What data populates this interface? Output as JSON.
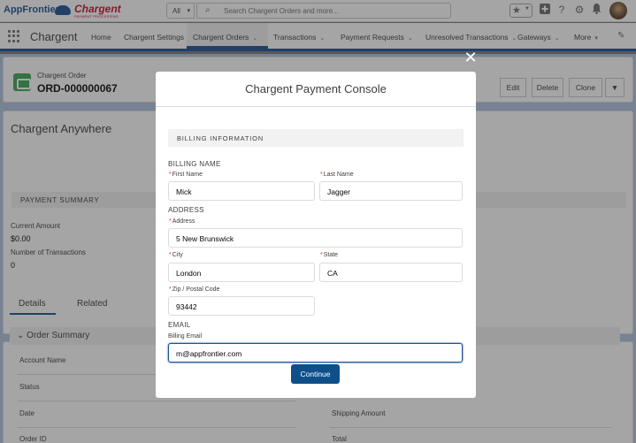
{
  "topbar": {
    "logo_appfrontier": "AppFrontier",
    "logo_chargent": "Chargent",
    "logo_chargent_sub": "PAYMENT PROCESSING",
    "search_scope": "All",
    "search_placeholder": "Search Chargent Orders and more..."
  },
  "nav": {
    "app_name": "Chargent",
    "items": [
      {
        "label": "Home"
      },
      {
        "label": "Chargent Settings"
      },
      {
        "label": "Chargent Orders"
      },
      {
        "label": "Transactions"
      },
      {
        "label": "Payment Requests"
      },
      {
        "label": "Unresolved Transactions"
      },
      {
        "label": "Gateways"
      },
      {
        "label": "More"
      }
    ]
  },
  "record": {
    "type": "Chargent Order",
    "name": "ORD-000000067",
    "actions": [
      "Edit",
      "Delete",
      "Clone"
    ]
  },
  "anywhere": {
    "title": "Chargent Anywhere",
    "payment_summary": "PAYMENT SUMMARY",
    "current_amount_label": "Current Amount",
    "current_amount_value": "$0.00",
    "num_transactions_label": "Number of Transactions",
    "num_transactions_value": "0"
  },
  "details": {
    "tabs": [
      "Details",
      "Related"
    ],
    "order_summary": "Order Summary",
    "fields": [
      "Account Name",
      "Status",
      "Date",
      "Order ID"
    ],
    "right_fields": [
      "Shipping Amount",
      "Total"
    ]
  },
  "modal": {
    "title": "Chargent Payment Console",
    "section": "BILLING INFORMATION",
    "billing_name_group": "BILLING NAME",
    "first_name_label": "First Name",
    "first_name_value": "Mick",
    "last_name_label": "Last Name",
    "last_name_value": "Jagger",
    "address_group": "ADDRESS",
    "address_label": "Address",
    "address_value": "5 New Brunswick",
    "city_label": "City",
    "city_value": "London",
    "state_label": "State",
    "state_value": "CA",
    "zip_label": "Zip / Postal Code",
    "zip_value": "93442",
    "email_group": "EMAIL",
    "billing_email_label": "Billing Email",
    "billing_email_value": "m@appfrontier.com",
    "continue_label": "Continue",
    "required_mark": "*"
  },
  "colors": {
    "brand": "#1b5297",
    "primary_button": "#0e4f8a",
    "required": "#c23934"
  }
}
